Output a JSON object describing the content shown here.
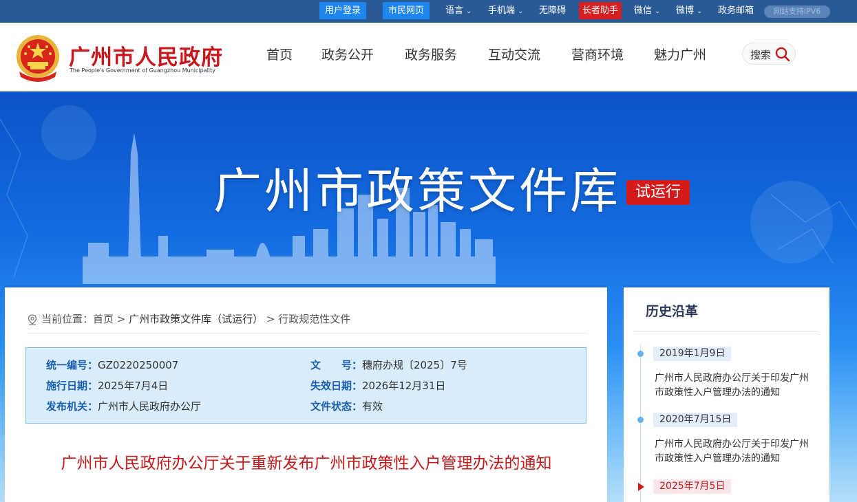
{
  "topbar": {
    "login": "用户登录",
    "citizen_page": "市民网页",
    "language": "语言",
    "mobile": "手机端",
    "accessibility": "无障碍",
    "elderly": "长者助手",
    "wechat": "微信",
    "weibo": "微博",
    "mail": "政务邮箱",
    "ipv6": "网站支持IPV6"
  },
  "header": {
    "site_name": "广州市人民政府",
    "site_name_en": "The People's Government of Guangzhou Municipality",
    "nav": [
      "首页",
      "政务公开",
      "政务服务",
      "互动交流",
      "营商环境",
      "魅力广州"
    ],
    "search_label": "搜索"
  },
  "banner": {
    "title": "广州市政策文件库",
    "badge": "试运行"
  },
  "breadcrumb": {
    "label": "当前位置：",
    "home": "首页",
    "sep1": " > ",
    "library": "广州市政策文件库（试运行）",
    "sep2": " > ",
    "category": "行政规范性文件"
  },
  "doc_info": {
    "code_key": "统一编号：",
    "code_value": "GZ0220250007",
    "number_key": "文　　号：",
    "number_value": "穗府办规〔2025〕7号",
    "effective_key": "施行日期：",
    "effective_value": "2025年7月4日",
    "expiry_key": "失效日期：",
    "expiry_value": "2026年12月31日",
    "issuer_key": "发布机关：",
    "issuer_value": "广州市人民政府办公厅",
    "status_key": "文件状态：",
    "status_value": "有效"
  },
  "doc_title": "广州市人民政府办公厅关于重新发布广州市政策性入户管理办法的通知",
  "sidebar": {
    "title": "历史沿革",
    "history": [
      {
        "date": "2019年1月9日",
        "text": "广州市人民政府办公厅关于印发广州市政策性入户管理办法的通知"
      },
      {
        "date": "2020年7月15日",
        "text": "广州市人民政府办公厅关于印发广州市政策性入户管理办法的通知"
      },
      {
        "date": "2025年7月5日",
        "text": ""
      }
    ]
  },
  "colors": {
    "brand_red": "#c8161d",
    "topbar_blue": "#2a5a96",
    "accent_blue": "#1f6fd6",
    "info_bg": "#d9ecfb"
  }
}
